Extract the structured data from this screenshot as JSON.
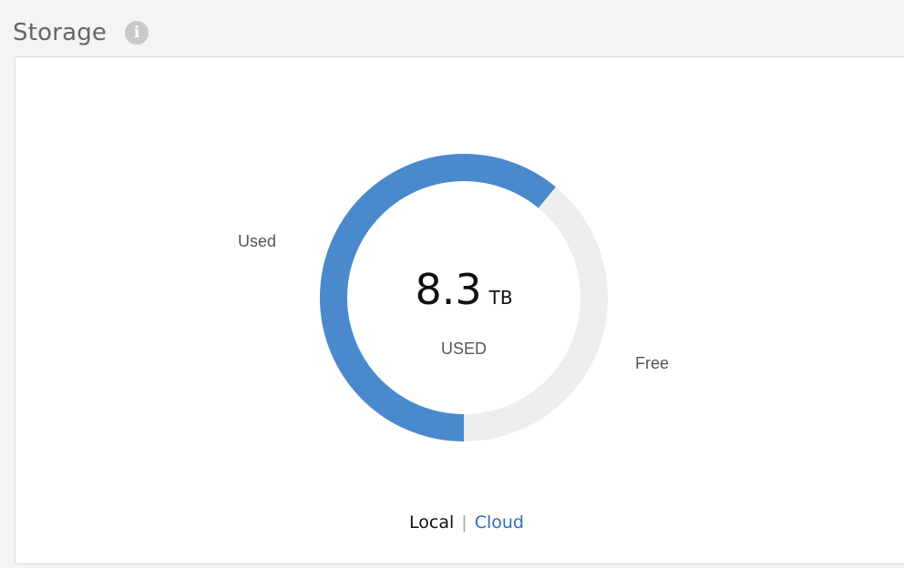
{
  "header": {
    "title": "Storage",
    "info_glyph": "i"
  },
  "storage_chart": {
    "used_label": "Used",
    "free_label": "Free",
    "value": "8.3",
    "unit": "TB",
    "caption": "USED",
    "used_fraction": 0.61,
    "colors": {
      "used": "#4a89cc",
      "free": "#eeeeee"
    }
  },
  "switcher": {
    "local": "Local",
    "separator": "|",
    "cloud": "Cloud"
  }
}
